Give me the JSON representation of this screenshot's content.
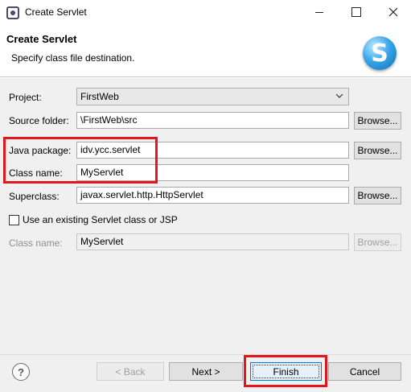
{
  "window": {
    "title": "Create Servlet",
    "app_icon": "servlet-app-icon"
  },
  "header": {
    "title": "Create Servlet",
    "subtitle": "Specify class file destination.",
    "logo_letter": "S"
  },
  "form": {
    "project_label": "Project:",
    "project_value": "FirstWeb",
    "source_folder_label": "Source folder:",
    "source_folder_value": "\\FirstWeb\\src",
    "java_package_label": "Java package:",
    "java_package_value": "idv.ycc.servlet",
    "class_name_label": "Class name:",
    "class_name_value": "MyServlet",
    "superclass_label": "Superclass:",
    "superclass_value": "javax.servlet.http.HttpServlet",
    "browse_label": "Browse...",
    "use_existing_label": "Use an existing Servlet class or JSP",
    "use_existing_checked": false,
    "existing_class_name_label": "Class name:",
    "existing_class_name_value": "MyServlet"
  },
  "footer": {
    "help_symbol": "?",
    "back_label": "< Back",
    "next_label": "Next >",
    "finish_label": "Finish",
    "cancel_label": "Cancel"
  },
  "colors": {
    "highlight": "#e3171b",
    "dialog_bg": "#f0f0f0",
    "primary_border": "#0078d7"
  }
}
